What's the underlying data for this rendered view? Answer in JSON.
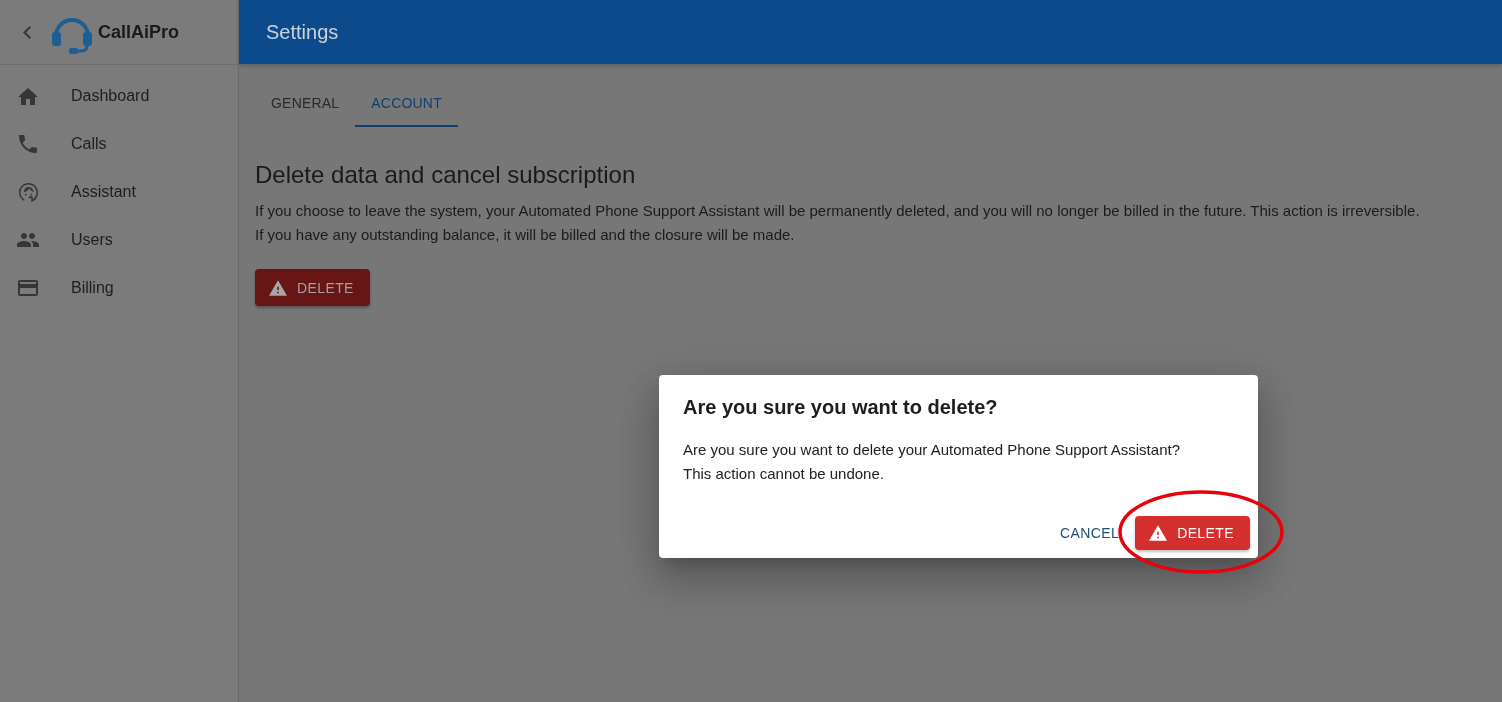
{
  "sidebar": {
    "logo_text": "CallAiPro",
    "items": [
      {
        "label": "Dashboard",
        "selected": false
      },
      {
        "label": "Calls",
        "selected": false
      },
      {
        "label": "Assistant",
        "selected": false
      },
      {
        "label": "Users",
        "selected": false
      },
      {
        "label": "Billing",
        "selected": false
      }
    ]
  },
  "header": {
    "title": "Settings"
  },
  "tabs": [
    {
      "label": "GENERAL",
      "selected": false
    },
    {
      "label": "ACCOUNT",
      "selected": true
    }
  ],
  "section": {
    "heading": "Delete data and cancel subscription",
    "lines": [
      "If you choose to leave the system, your Automated Phone Support Assistant will be permanently deleted, and you will no longer be billed in the future. This action is irreversible.",
      "If you have any outstanding balance, it will be billed and the closure will be made."
    ],
    "button": {
      "label": "DELETE"
    }
  },
  "dialog": {
    "title": "Are you sure you want to delete?",
    "lines": [
      "Are you sure you want to delete your Automated Phone Support Assistant?",
      "This action cannot be undone."
    ],
    "buttons": [
      {
        "label": "CANCEL",
        "kind": "text"
      },
      {
        "label": "DELETE",
        "kind": "danger"
      }
    ]
  }
}
